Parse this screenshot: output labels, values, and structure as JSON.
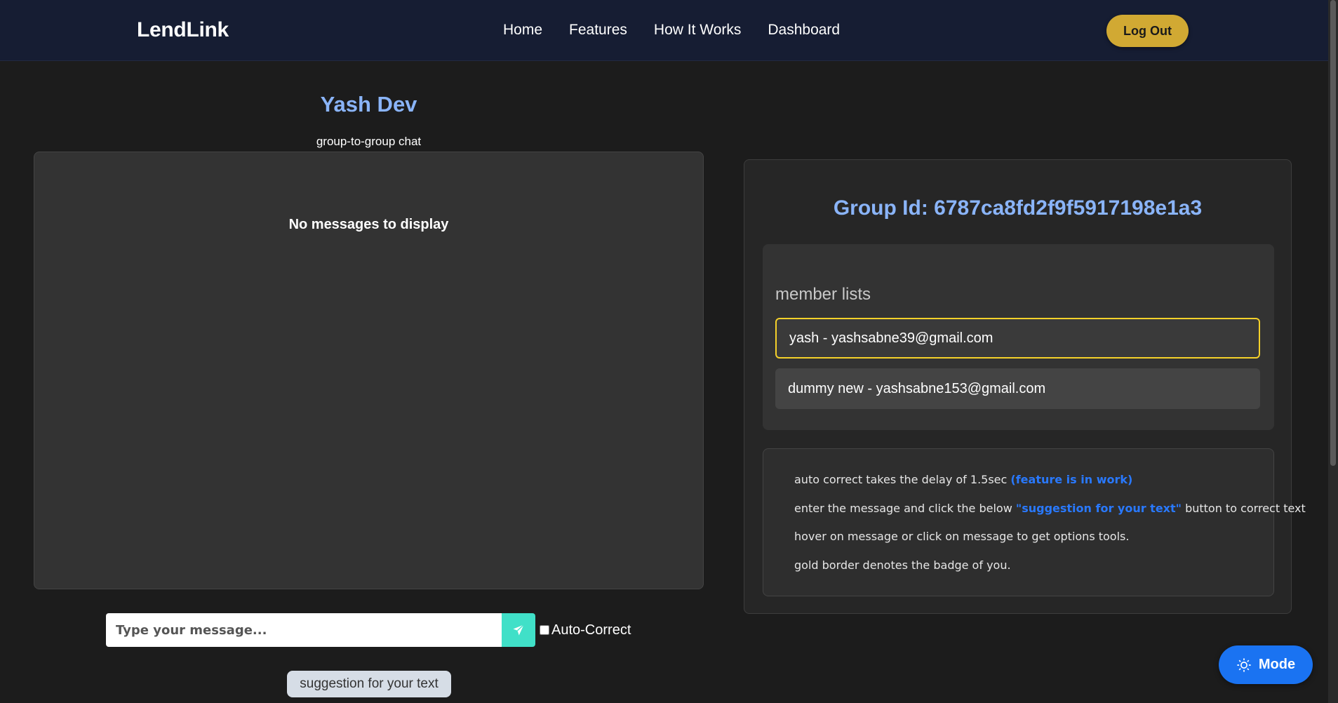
{
  "nav": {
    "brand": "LendLink",
    "links": [
      "Home",
      "Features",
      "How It Works",
      "Dashboard"
    ],
    "logout_label": "Log Out"
  },
  "chat": {
    "user_name": "Yash Dev",
    "chat_type": "group-to-group chat",
    "empty_text": "No messages to display",
    "input_placeholder": "Type your message...",
    "autocorrect_label": "Auto-Correct",
    "suggestion_button": "suggestion for your text"
  },
  "group": {
    "title": "Group Id: 6787ca8fd2f9f5917198e1a3",
    "members_title": "member lists",
    "members": [
      {
        "label": "yash - yashsabne39@gmail.com",
        "is_you": true
      },
      {
        "label": "dummy new - yashsabne153@gmail.com",
        "is_you": false
      }
    ],
    "info": {
      "line1_text": "auto correct takes the delay of 1.5sec ",
      "line1_highlight": "(feature is in work)",
      "line2_text_a": "enter the message and click the below ",
      "line2_highlight": "\"suggestion for your text\"",
      "line2_text_b": " button to correct text",
      "line3_text": "hover on message or click on message to get options tools.",
      "line4_text": "gold border denotes the badge of you."
    }
  },
  "mode_button": "Mode",
  "colors": {
    "accent_blue": "#8ab4f8",
    "gold": "#d1a933",
    "teal": "#40e0c8",
    "mode_blue": "#1a73f2"
  }
}
